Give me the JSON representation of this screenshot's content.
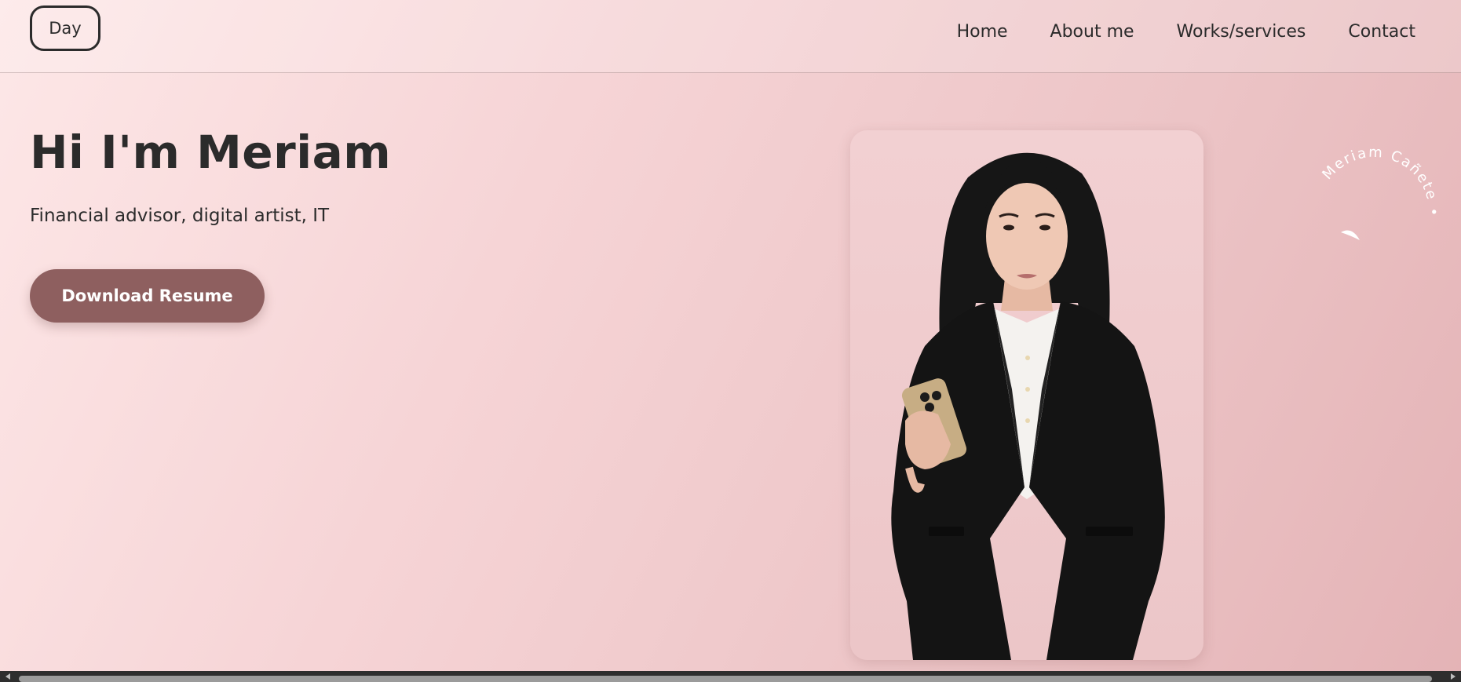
{
  "header": {
    "mode_toggle_label": "Day",
    "nav": [
      {
        "label": "Home"
      },
      {
        "label": "About me"
      },
      {
        "label": "Works/services"
      },
      {
        "label": "Contact"
      }
    ]
  },
  "hero": {
    "title": "Hi I'm Meriam",
    "subtitle": "Financial advisor, digital artist, IT",
    "download_label": "Download Resume"
  },
  "badge": {
    "circle_text": "Meriam Cañete •"
  },
  "colors": {
    "button_bg": "#8e5f5f",
    "text_dark": "#2b2b2b",
    "page_bg_start": "#fde7e7",
    "page_bg_end": "#e4b3b6"
  },
  "icons": {
    "badge_glyph": "leaf-icon",
    "scroll_left": "triangle-left-icon",
    "scroll_right": "triangle-right-icon"
  }
}
